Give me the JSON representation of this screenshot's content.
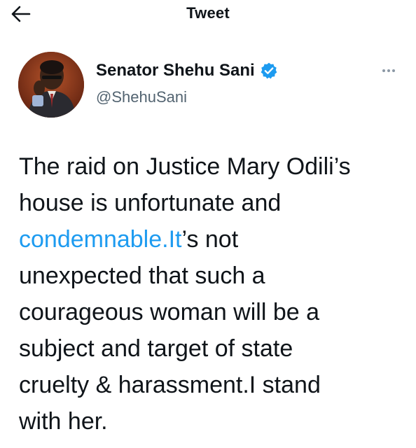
{
  "header": {
    "title": "Tweet",
    "back_icon": "arrow-left-icon"
  },
  "author": {
    "display_name": "Senator Shehu Sani",
    "handle": "@ShehuSani",
    "verified_icon": "verified-badge-icon",
    "more_icon": "more-horizontal-icon"
  },
  "tweet": {
    "text_before_link": "The raid on Justice Mary Odili’s\nhouse is unfortunate and\n",
    "link_text": "condemnable.It",
    "text_after_link": "’s not\nunexpected that such a\ncourageous woman will be a\nsubject and target of state\ncruelty & harassment.I stand\nwith her."
  },
  "colors": {
    "link": "#1d9bf0",
    "verified": "#1d9bf0",
    "text": "#0f1419",
    "secondary": "#536471"
  }
}
